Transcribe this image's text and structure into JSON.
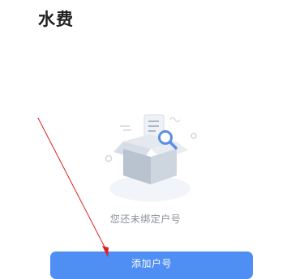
{
  "header": {
    "title": "水费"
  },
  "empty_state": {
    "illustration_icon": "empty-box-search-icon",
    "message": "您还未绑定户号"
  },
  "actions": {
    "add_account_label": "添加户号"
  },
  "colors": {
    "primary_button": "#4f8ef3",
    "annotation_arrow": "#e02020",
    "title_text": "#222222",
    "muted_text": "#8a8f99"
  }
}
